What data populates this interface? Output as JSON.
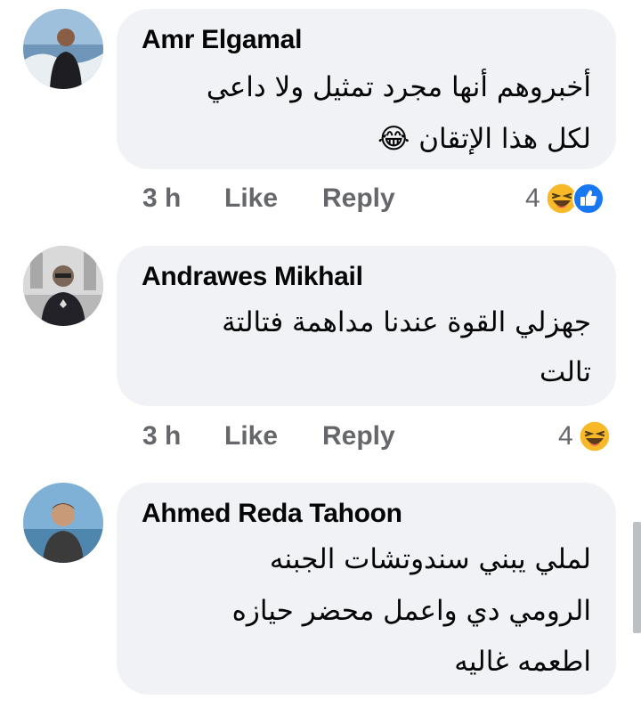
{
  "comments": [
    {
      "author": "Amr Elgamal",
      "lines": [
        "أخبروهم أنها مجرد تمثيل ولا داعي",
        "لكل هذا الإتقان 😂"
      ],
      "time": "3 h",
      "like_label": "Like",
      "reply_label": "Reply",
      "reaction_count": "4",
      "reactions": [
        "haha-icon",
        "like-icon"
      ]
    },
    {
      "author": "Andrawes Mikhail",
      "lines": [
        "جهزلي القوة عندنا مداهمة فتالتة",
        "تالت"
      ],
      "time": "3 h",
      "like_label": "Like",
      "reply_label": "Reply",
      "reaction_count": "4",
      "reactions": [
        "haha-icon"
      ]
    },
    {
      "author": "Ahmed Reda Tahoon",
      "lines": [
        "لملي يبني سندوتشات الجبنه",
        "الرومي دي واعمل محضر حيازه",
        "اطعمه غاليه"
      ]
    }
  ],
  "colors": {
    "bubble": "#f0f2f5",
    "name": "#050505",
    "meta": "#65676b",
    "like_blue": "#1877f2",
    "haha_yellow": "#f7b928"
  }
}
